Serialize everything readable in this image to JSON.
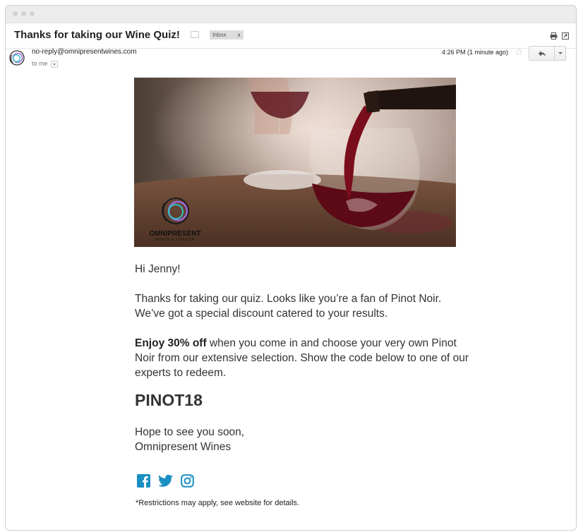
{
  "email": {
    "subject": "Thanks for taking our Wine Quiz!",
    "label": "Inbox",
    "label_remove": "x",
    "sender_email": "no-reply@omnipresentwines.com",
    "recipient": "to me",
    "timestamp": "4:26 PM (1 minute ago)"
  },
  "hero": {
    "brand_name": "OMNIPRESENT",
    "brand_tagline": "WINES & CHEESE"
  },
  "message": {
    "greeting": "Hi Jenny!",
    "paragraph1": "Thanks for taking our quiz. Looks like you’re a fan of Pinot Noir. We’ve got a special discount catered to your results.",
    "offer_bold": "Enjoy 30% off",
    "offer_rest": " when you come in and choose your very own Pinot Noir from our extensive selection. Show the code below to one of our experts to redeem.",
    "promo_code": "PINOT18",
    "signoff_line1": "Hope to see you soon,",
    "signoff_line2": "Omnipresent Wines",
    "disclaimer": "*Restrictions may apply, see website for details."
  },
  "social": [
    "facebook-icon",
    "twitter-icon",
    "instagram-icon"
  ],
  "colors": {
    "social_blue": "#1a8fc2",
    "wine_red": "#6a0f1a",
    "logo_teal": "#2ec4c4",
    "logo_purple": "#9a6ad8"
  }
}
